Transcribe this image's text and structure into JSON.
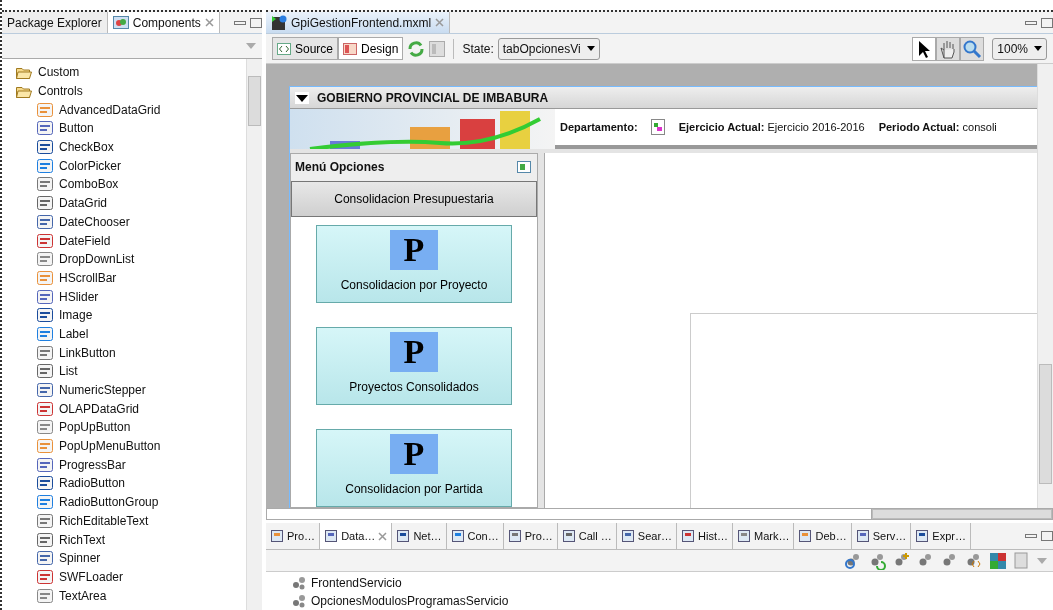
{
  "left_panel": {
    "tabs": [
      {
        "label": "Package Explorer",
        "selected": false
      },
      {
        "label": "Components",
        "selected": true
      }
    ],
    "tree": [
      {
        "label": "Custom",
        "expanded": true
      },
      {
        "label": "Controls",
        "expanded": true,
        "children": [
          {
            "label": "AdvancedDataGrid"
          },
          {
            "label": "Button"
          },
          {
            "label": "CheckBox"
          },
          {
            "label": "ColorPicker"
          },
          {
            "label": "ComboBox"
          },
          {
            "label": "DataGrid"
          },
          {
            "label": "DateChooser"
          },
          {
            "label": "DateField"
          },
          {
            "label": "DropDownList"
          },
          {
            "label": "HScrollBar"
          },
          {
            "label": "HSlider"
          },
          {
            "label": "Image"
          },
          {
            "label": "Label"
          },
          {
            "label": "LinkButton"
          },
          {
            "label": "List"
          },
          {
            "label": "NumericStepper"
          },
          {
            "label": "OLAPDataGrid"
          },
          {
            "label": "PopUpButton"
          },
          {
            "label": "PopUpMenuButton"
          },
          {
            "label": "ProgressBar"
          },
          {
            "label": "RadioButton"
          },
          {
            "label": "RadioButtonGroup"
          },
          {
            "label": "RichEditableText"
          },
          {
            "label": "RichText"
          },
          {
            "label": "Spinner"
          },
          {
            "label": "SWFLoader"
          },
          {
            "label": "TextArea"
          }
        ]
      }
    ]
  },
  "editor": {
    "tab": "GpiGestionFrontend.mxml",
    "modes": [
      {
        "label": "Source",
        "selected": false
      },
      {
        "label": "Design",
        "selected": true
      }
    ],
    "state_label": "State:",
    "state_value": "tabOpcionesVi",
    "tools": [
      {
        "kind": "pointer",
        "selected": true
      },
      {
        "kind": "hand",
        "selected": false
      },
      {
        "kind": "zoom",
        "selected": false
      }
    ],
    "zoom_value": "100%"
  },
  "design": {
    "header": "GOBIERNO PROVINCIAL DE IMBABURA",
    "info": [
      {
        "label": "Departamento:",
        "kind": "image"
      },
      {
        "label": "Ejercicio Actual:",
        "value": "Ejercicio 2016-2016",
        "kind": "text"
      },
      {
        "label": "Periodo Actual:",
        "value": "consoli",
        "kind": "text"
      }
    ],
    "menu_title": "Menú Opciones",
    "section": "Consolidacion Presupuestaria",
    "cards": [
      {
        "letter": "P",
        "label": "Consolidacion por Proyecto"
      },
      {
        "letter": "P",
        "label": "Proyectos Consolidados"
      },
      {
        "letter": "P",
        "label": "Consolidacion por Partida"
      }
    ]
  },
  "bottom_panel": {
    "tabs": [
      {
        "label": "Pro…",
        "selected": false
      },
      {
        "label": "Data…",
        "selected": true
      },
      {
        "label": "Net…",
        "selected": false
      },
      {
        "label": "Con…",
        "selected": false
      },
      {
        "label": "Pro…",
        "selected": false
      },
      {
        "label": "Call …",
        "selected": false
      },
      {
        "label": "Sear…",
        "selected": false
      },
      {
        "label": "Hist…",
        "selected": false
      },
      {
        "label": "Mark…",
        "selected": false
      },
      {
        "label": "Deb…",
        "selected": false
      },
      {
        "label": "Serv…",
        "selected": false
      },
      {
        "label": "Expr…",
        "selected": false
      }
    ],
    "services": [
      "FrontendServicio",
      "OpcionesModulosProgramasServicio"
    ]
  }
}
